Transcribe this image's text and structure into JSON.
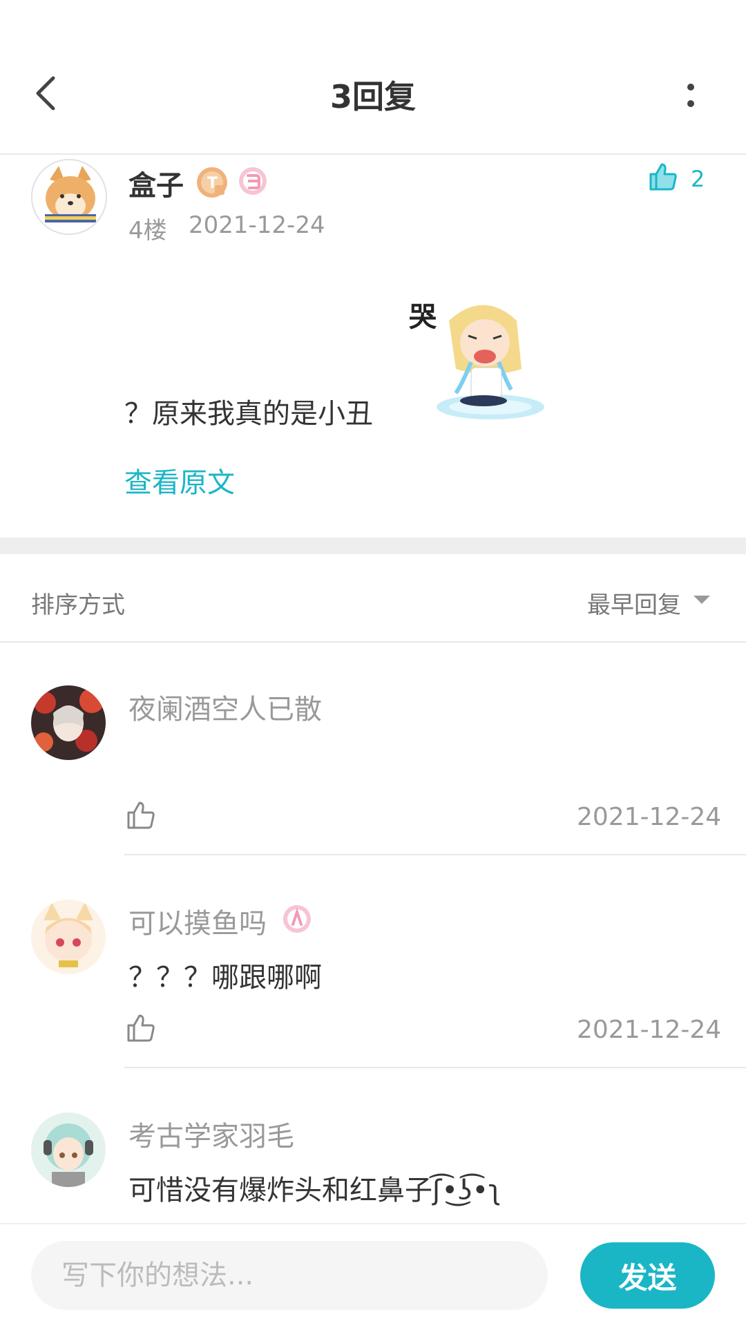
{
  "header": {
    "title": "3回复"
  },
  "main_post": {
    "username": "盒子",
    "floor": "4楼",
    "date": "2021-12-24",
    "like_count": "2",
    "text": "？原来我真的是小丑",
    "view_original_label": "查看原文"
  },
  "sort": {
    "label": "排序方式",
    "value": "最早回复"
  },
  "replies": [
    {
      "username": "夜阑酒空人已散",
      "text": "",
      "date": "2021-12-24"
    },
    {
      "username": "可以摸鱼吗",
      "text": "？？？哪跟哪啊",
      "date": "2021-12-24"
    },
    {
      "username": "考古学家羽毛",
      "text": "可惜没有爆炸头和红鼻子ʃ͡•͜ʖ͡•ʅ",
      "date": ""
    }
  ],
  "composer": {
    "placeholder": "写下你的想法...",
    "send_label": "发送"
  },
  "colors": {
    "accent": "#1ab6c6",
    "badge_orange": "#f0b27a",
    "badge_pink": "#f19bb5"
  },
  "icons": [
    "back-arrow-icon",
    "more-vertical-icon",
    "thumbs-up-icon",
    "level-badge-icon",
    "vip-badge-icon",
    "sort-caret-icon"
  ]
}
